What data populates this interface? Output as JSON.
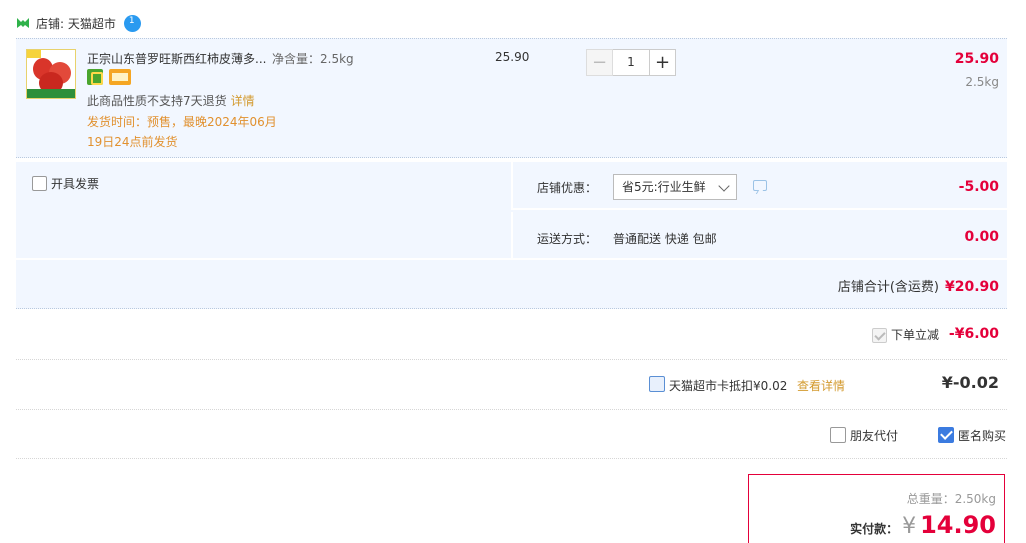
{
  "shop": {
    "label": "店铺: 天猫超市",
    "logo_icon": "tmall-cat-icon",
    "chat_icon": "wangwang-chat-icon"
  },
  "item": {
    "title": "正宗山东普罗旺斯西红柿皮薄多...",
    "spec": "净含量：2.5kg",
    "notice": "此商品性质不支持7天退货",
    "detail_link": "详情",
    "ship_time": "发货时间：预售，最晚2024年06月19日24点前发货",
    "unit_price": "25.90",
    "quantity": "1",
    "minus_label": "−",
    "plus_label": "+",
    "subtotal": "25.90",
    "weight": "2.5kg"
  },
  "options": {
    "invoice_label": "开具发票",
    "shop_promo_label": "店铺优惠：",
    "shop_promo_value": "省5元:行业生鲜",
    "shop_promo_amount": "-5.00",
    "ship_label": "运送方式：",
    "ship_value": "普通配送 快递 包邮",
    "ship_amount": "0.00",
    "shop_total_label": "店铺合计(含运费)",
    "shop_total_amount": "¥20.90"
  },
  "discount": {
    "label": "下单立减",
    "amount": "-¥6.00"
  },
  "card": {
    "label": "天猫超市卡抵扣¥0.02",
    "link": "查看详情",
    "amount": "¥-0.02"
  },
  "pay_options": {
    "friend_label": "朋友代付",
    "anon_label": "匿名购买"
  },
  "summary": {
    "weight": "总重量：2.50kg",
    "pay_label": "实付款：",
    "currency": "¥",
    "amount": "14.90"
  },
  "colors": {
    "accent_red": "#e4003a",
    "panel_bg": "#f2f7ff",
    "link_orange": "#d39a2e",
    "checkbox_blue": "#3b7be0"
  }
}
